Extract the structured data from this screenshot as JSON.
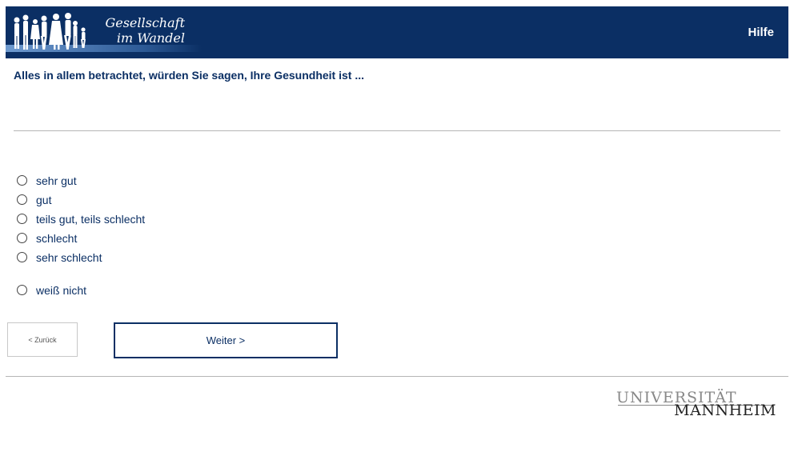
{
  "header": {
    "logo": {
      "line1": "Gesellschaft",
      "line2": "im Wandel"
    },
    "help_label": "Hilfe"
  },
  "question": {
    "text": "Alles in allem betrachtet, würden Sie sagen, Ihre Gesundheit ist ..."
  },
  "options": [
    {
      "label": "sehr gut",
      "selected": false
    },
    {
      "label": "gut",
      "selected": false
    },
    {
      "label": "teils gut, teils schlecht",
      "selected": false
    },
    {
      "label": "schlecht",
      "selected": false
    },
    {
      "label": "sehr schlecht",
      "selected": false
    },
    {
      "label": "weiß nicht",
      "selected": false
    }
  ],
  "navigation": {
    "back_label": "< Zurück",
    "next_label": "Weiter >"
  },
  "footer": {
    "university_top": "UNIVERSITÄT",
    "university_bottom": "MANNHEIM"
  },
  "colors": {
    "brand_navy": "#0b2f64",
    "divider": "#b5b5b5"
  }
}
